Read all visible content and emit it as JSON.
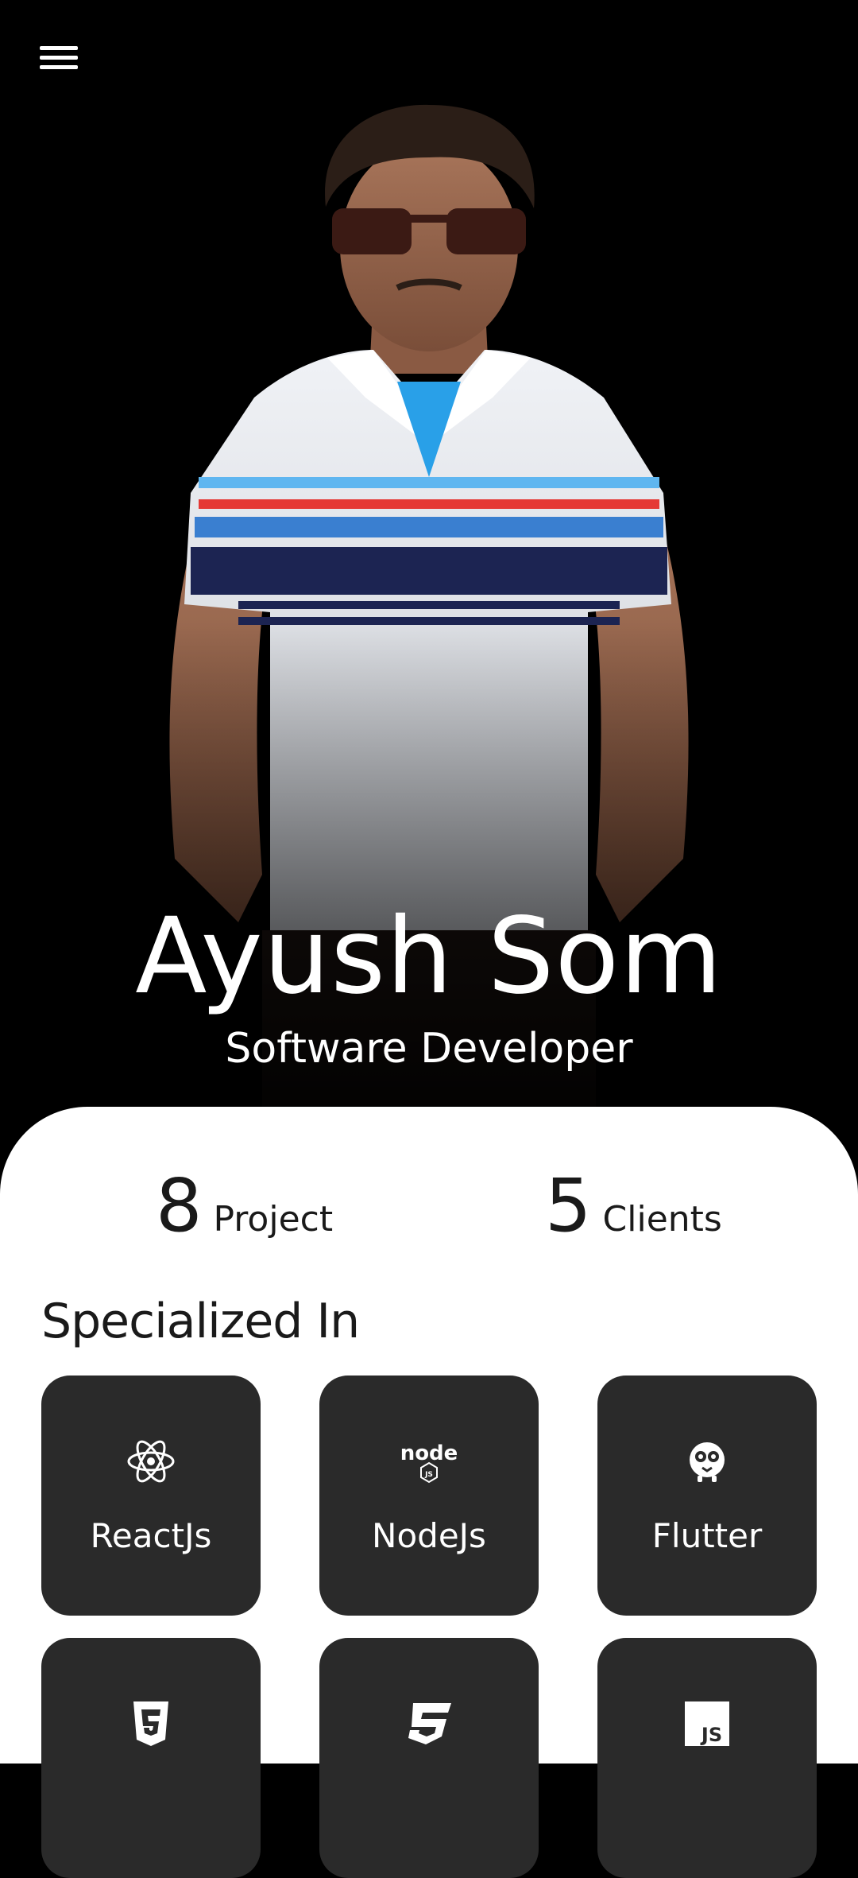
{
  "hero": {
    "name": "Ayush Som",
    "role": "Software Developer"
  },
  "stats": [
    {
      "value": "8",
      "label": "Project"
    },
    {
      "value": "5",
      "label": "Clients"
    }
  ],
  "specialized": {
    "title": "Specialized In",
    "skills": [
      {
        "label": "ReactJs",
        "icon": "react-icon"
      },
      {
        "label": "NodeJs",
        "icon": "nodejs-icon"
      },
      {
        "label": "Flutter",
        "icon": "flutter-icon"
      },
      {
        "label": "",
        "icon": "html5-icon"
      },
      {
        "label": "",
        "icon": "css3-icon"
      },
      {
        "label": "",
        "icon": "javascript-icon"
      }
    ]
  },
  "colors": {
    "background": "#000000",
    "panel": "#ffffff",
    "tile": "#2a2a2a",
    "text_dark": "#1a1a1a",
    "text_light": "#ffffff"
  }
}
